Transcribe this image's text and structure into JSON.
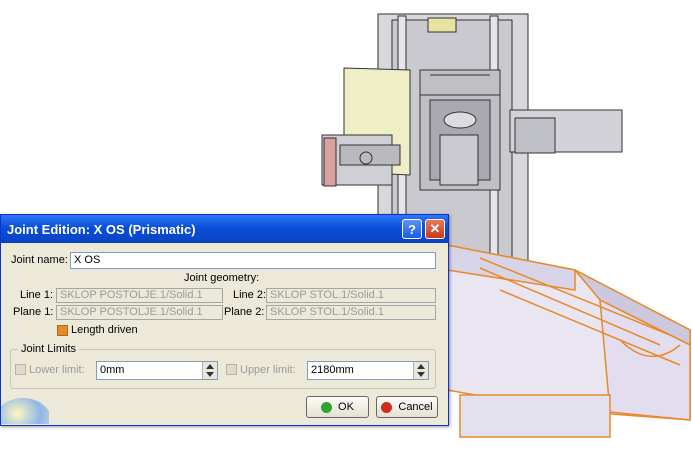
{
  "dialog": {
    "title": "Joint Edition: X OS (Prismatic)",
    "help_label": "?",
    "close_label": "✕",
    "joint_name_label": "Joint name:",
    "joint_name_value": "X OS",
    "joint_geometry_label": "Joint geometry:",
    "line1_label": "Line 1:",
    "line1_value": "SKLOP POSTOLJE.1/Solid.1",
    "line2_label": "Line 2:",
    "line2_value": "SKLOP STOL.1/Solid.1",
    "plane1_label": "Plane 1:",
    "plane1_value": "SKLOP POSTOLJE.1/Solid.1",
    "plane2_label": "Plane 2:",
    "plane2_value": "SKLOP STOL.1/Solid.1",
    "length_driven_label": "Length driven",
    "joint_limits_label": "Joint Limits",
    "lower_limit_label": "Lower limit:",
    "lower_limit_value": "0mm",
    "upper_limit_label": "Upper limit:",
    "upper_limit_value": "2180mm",
    "ok_label": "OK",
    "cancel_label": "Cancel"
  },
  "colors": {
    "titlebar": "#0a4fd8",
    "dialog_bg": "#ece9d8",
    "model_highlight": "#e8892a",
    "ok_icon": "#2fa52f",
    "cancel_icon": "#d42a1a"
  }
}
